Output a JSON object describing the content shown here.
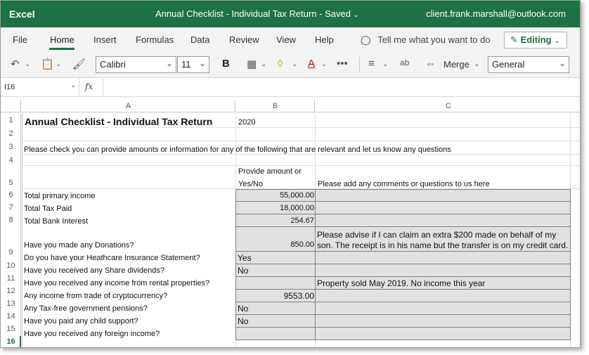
{
  "titlebar": {
    "app": "Excel",
    "document": "Annual Checklist - Individual Tax Return",
    "saved_status": "Saved",
    "user": "client.frank.marshall@outlook.com"
  },
  "ribbon": {
    "tabs": [
      "File",
      "Home",
      "Insert",
      "Formulas",
      "Data",
      "Review",
      "View",
      "Help"
    ],
    "active_tab": "Home",
    "tell_me": "Tell me what you want to do",
    "editing": "Editing"
  },
  "toolbar": {
    "font": "Calibri",
    "size": "11",
    "bold": "B",
    "merge": "Merge",
    "number_format": "General",
    "more": "•••"
  },
  "formula_bar": {
    "name_box": "I16",
    "fx": "fx"
  },
  "columns": [
    "A",
    "B",
    "C"
  ],
  "rows": [
    "1",
    "2",
    "3",
    "4",
    "5",
    "6",
    "7",
    "8",
    "9",
    "10",
    "11",
    "12",
    "13",
    "14",
    "15",
    "16"
  ],
  "active_row": "16",
  "sheet": {
    "title": "Annual Checklist - Individual Tax Return",
    "year": "2020",
    "instructions": "Please check you can provide amounts or information for any of the following that are relevant and let us know any questions",
    "header_b_line1": "Provide amount or",
    "header_b_line2": "Yes/No",
    "header_c": "Please add any comments or questions to us here",
    "items": [
      {
        "row": "6",
        "label": "Total primary income",
        "value": "55,000.00",
        "align": "right",
        "comment": ""
      },
      {
        "row": "7",
        "label": "Total Tax Paid",
        "value": "18,000.00",
        "align": "right",
        "comment": ""
      },
      {
        "row": "8",
        "label": "Total Bank Interest",
        "value": "254.67",
        "align": "right",
        "comment": ""
      },
      {
        "row": "9",
        "label": "Have you made any Donations?",
        "value": "850.00",
        "align": "right",
        "comment_line1": "Please advise if I can claim an extra $200 made on behalf of my",
        "comment_line2": "son. The receipt is in his name but the transfer is on my credit card."
      },
      {
        "row": "10",
        "label": "Do you have your Heathcare Insurance Statement?",
        "value": "Yes",
        "align": "left",
        "comment": ""
      },
      {
        "row": "11",
        "label": "Have you received any Share dividends?",
        "value": "No",
        "align": "left",
        "comment": ""
      },
      {
        "row": "12",
        "label": "Have you received any income from rental properties?",
        "value": "",
        "align": "left",
        "comment": "Property sold May 2019. No income this year"
      },
      {
        "row": "13",
        "label": "Any income from trade of cryptocurrency?",
        "value": "9553.00",
        "align": "right",
        "comment": ""
      },
      {
        "row": "14",
        "label": "Any Tax-free government pensions?",
        "value": "No",
        "align": "left",
        "comment": ""
      },
      {
        "row": "15",
        "label": "Have you paid any child support?",
        "value": "No",
        "align": "left",
        "comment": ""
      },
      {
        "row": "16",
        "label": "Have you received any foreign income?",
        "value": "",
        "align": "left",
        "comment": ""
      }
    ]
  },
  "colors": {
    "brand": "#1e7145",
    "ribbon_bg": "#f3f3f3",
    "input_cell": "#e1e1e1"
  }
}
